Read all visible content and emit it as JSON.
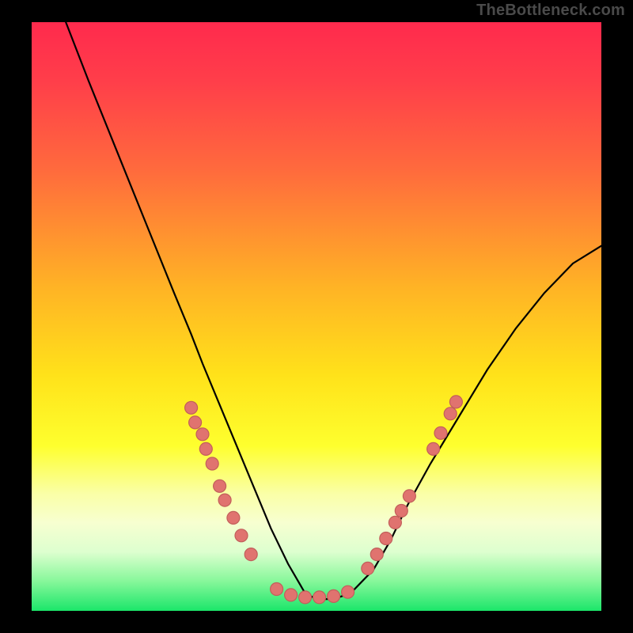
{
  "watermark": "TheBottleneck.com",
  "colors": {
    "frame": "#000000",
    "dot_fill": "#e0736f",
    "dot_stroke": "#c25e5a",
    "curve_stroke": "#000000",
    "gradient_stops": [
      {
        "offset": 0.0,
        "color": "#ff2a4d"
      },
      {
        "offset": 0.1,
        "color": "#ff3e4a"
      },
      {
        "offset": 0.25,
        "color": "#ff6a3d"
      },
      {
        "offset": 0.45,
        "color": "#ffb325"
      },
      {
        "offset": 0.6,
        "color": "#ffe21a"
      },
      {
        "offset": 0.72,
        "color": "#feff2e"
      },
      {
        "offset": 0.8,
        "color": "#faffa6"
      },
      {
        "offset": 0.85,
        "color": "#f7ffd0"
      },
      {
        "offset": 0.9,
        "color": "#ddffcf"
      },
      {
        "offset": 0.95,
        "color": "#86f79a"
      },
      {
        "offset": 1.0,
        "color": "#1be66a"
      }
    ]
  },
  "chart_data": {
    "type": "line",
    "title": "",
    "xlabel": "",
    "ylabel": "",
    "xlim": [
      0,
      100
    ],
    "ylim": [
      0,
      100
    ],
    "grid": false,
    "series": [
      {
        "name": "bottleneck-curve",
        "x": [
          6,
          10,
          15,
          20,
          25,
          28,
          30,
          33,
          36,
          39,
          42,
          45,
          48,
          50,
          53,
          56,
          60,
          63,
          66,
          70,
          75,
          80,
          85,
          90,
          95,
          100
        ],
        "y": [
          100,
          90,
          78,
          66,
          54,
          47,
          42,
          35,
          28,
          21,
          14,
          8,
          3,
          2,
          2,
          3,
          7,
          12,
          18,
          25,
          33,
          41,
          48,
          54,
          59,
          62
        ]
      }
    ],
    "scatter_clusters": [
      {
        "name": "left-arm-dots",
        "points": [
          {
            "x": 28.0,
            "y": 34.5
          },
          {
            "x": 28.7,
            "y": 32.0
          },
          {
            "x": 30.0,
            "y": 30.0
          },
          {
            "x": 30.6,
            "y": 27.5
          },
          {
            "x": 31.7,
            "y": 25.0
          },
          {
            "x": 33.0,
            "y": 21.2
          },
          {
            "x": 33.9,
            "y": 18.8
          },
          {
            "x": 35.4,
            "y": 15.8
          },
          {
            "x": 36.8,
            "y": 12.8
          },
          {
            "x": 38.5,
            "y": 9.6
          }
        ]
      },
      {
        "name": "bottom-dots",
        "points": [
          {
            "x": 43.0,
            "y": 3.7
          },
          {
            "x": 45.5,
            "y": 2.7
          },
          {
            "x": 48.0,
            "y": 2.3
          },
          {
            "x": 50.5,
            "y": 2.3
          },
          {
            "x": 53.0,
            "y": 2.5
          },
          {
            "x": 55.5,
            "y": 3.2
          }
        ]
      },
      {
        "name": "right-arm-dots",
        "points": [
          {
            "x": 59.0,
            "y": 7.2
          },
          {
            "x": 60.6,
            "y": 9.6
          },
          {
            "x": 62.2,
            "y": 12.3
          },
          {
            "x": 63.8,
            "y": 15.0
          },
          {
            "x": 64.9,
            "y": 17.0
          },
          {
            "x": 66.3,
            "y": 19.5
          },
          {
            "x": 70.5,
            "y": 27.5
          },
          {
            "x": 71.8,
            "y": 30.2
          },
          {
            "x": 73.5,
            "y": 33.5
          },
          {
            "x": 74.5,
            "y": 35.5
          }
        ]
      }
    ]
  }
}
